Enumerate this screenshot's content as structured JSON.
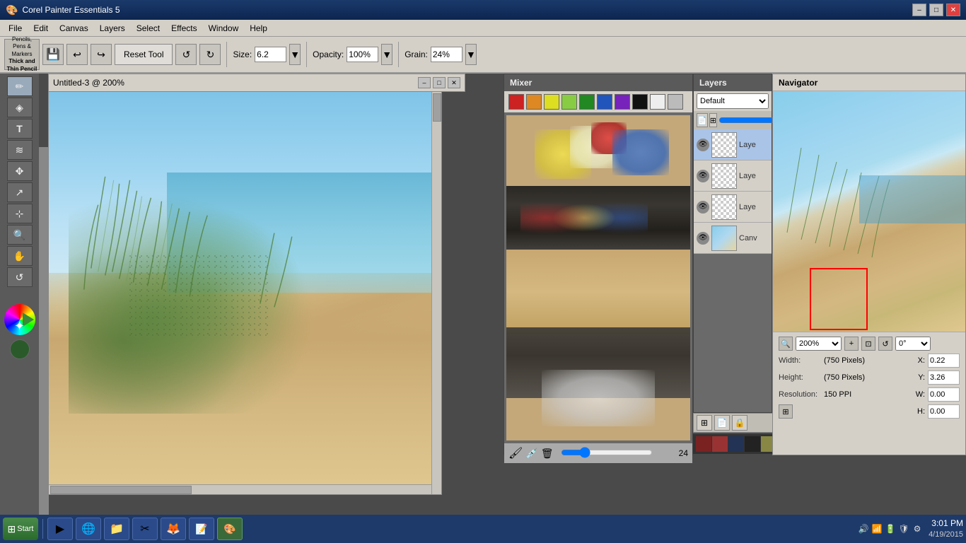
{
  "app": {
    "title": "Corel Painter Essentials 5",
    "icon": "🎨"
  },
  "title_bar": {
    "title": "Corel Painter Essentials 5",
    "minimize": "–",
    "maximize": "□",
    "close": "✕"
  },
  "menu": {
    "items": [
      "File",
      "Edit",
      "Canvas",
      "Layers",
      "Select",
      "Effects",
      "Window",
      "Help"
    ]
  },
  "toolbar": {
    "tool_name": "Pencils, Pens & Markers",
    "tool_subname": "Thick and Thin Pencil",
    "reset_label": "Reset Tool",
    "size_label": "Size:",
    "size_value": "6.2",
    "opacity_label": "Opacity:",
    "opacity_value": "100%",
    "grain_label": "Grain:",
    "grain_value": "24%"
  },
  "canvas_window": {
    "title": "Untitled-3 @ 200%",
    "minimize": "–",
    "maximize": "□",
    "close": "✕"
  },
  "mixer": {
    "title": "Mixer",
    "colors": [
      "#cc2222",
      "#dd8822",
      "#dddd22",
      "#44aa44",
      "#228822",
      "#2255bb",
      "#7722bb",
      "#111111",
      "#eeeeee",
      "#bbbbbb"
    ],
    "brush_size": 24
  },
  "layers": {
    "title": "Layers",
    "default_label": "Default",
    "items": [
      {
        "name": "Laye",
        "visible": true,
        "selected": true
      },
      {
        "name": "Laye",
        "visible": true,
        "selected": false
      },
      {
        "name": "Laye",
        "visible": true,
        "selected": false
      },
      {
        "name": "Canv",
        "visible": true,
        "selected": false,
        "is_canvas": true
      }
    ]
  },
  "navigator": {
    "title": "Navigator",
    "zoom": "200%",
    "width_label": "Width:",
    "width_value": "(750 Pixels)",
    "height_label": "Height:",
    "height_value": "(750 Pixels)",
    "resolution_label": "Resolution:",
    "resolution_value": "150 PPI",
    "x_label": "X:",
    "x_value": "0.22",
    "y_label": "Y:",
    "y_value": "3.26",
    "w_label": "W:",
    "w_value": "0.00",
    "h_label": "H:",
    "h_value": "0.00",
    "rotation": "0°"
  },
  "taskbar": {
    "start_label": "Start",
    "time": "3:01 PM",
    "date": "4/19/2015",
    "apps": [
      "▶",
      "🌐",
      "📁",
      "✂",
      "🦊",
      "📝",
      "🎨"
    ]
  },
  "left_tools": {
    "tools": [
      "✏",
      "◯",
      "T",
      "≋",
      "✥",
      "↗",
      "🔍",
      "✋",
      "↺",
      "◐"
    ]
  }
}
